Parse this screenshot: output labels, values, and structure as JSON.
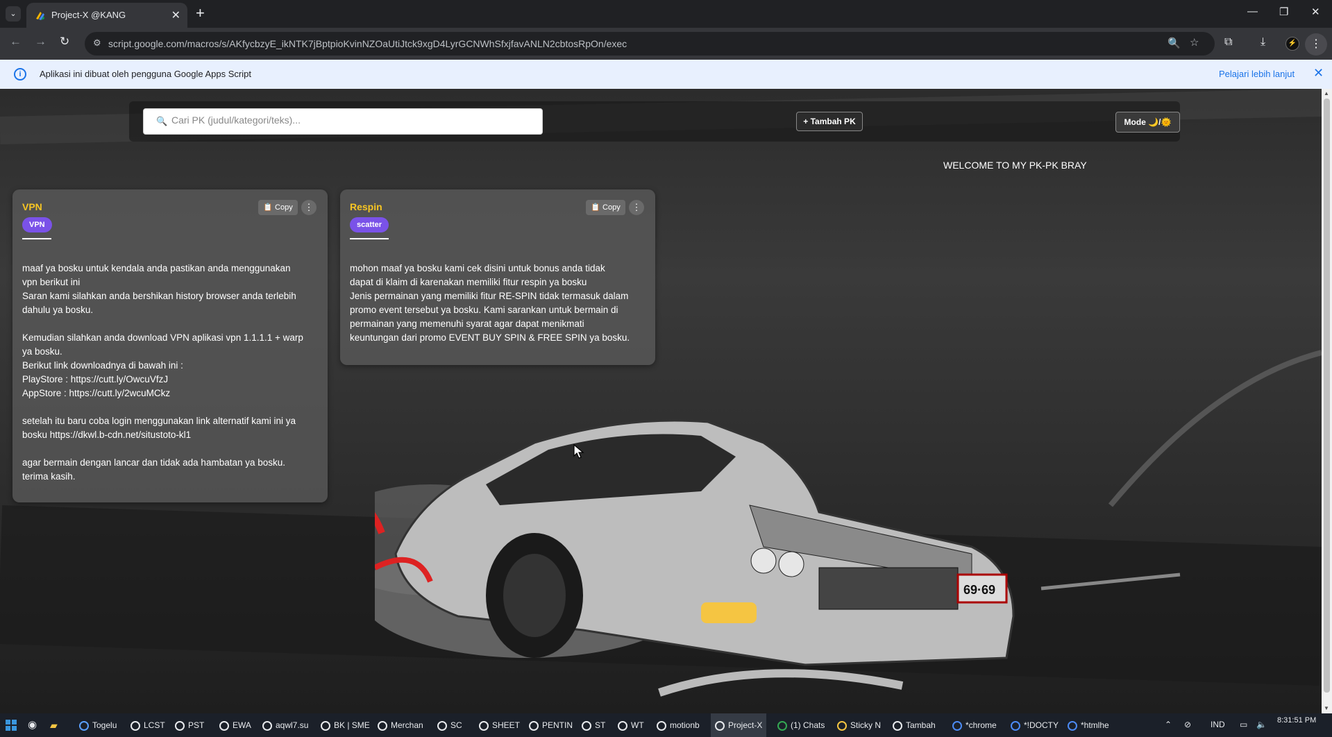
{
  "browser": {
    "tab": {
      "title": "Project-X @KANG"
    },
    "url": "script.google.com/macros/s/AKfycbzyE_ikNTK7jBptpioKvinNZOaUtiJtck9xgD4LyrGCNWhSfxjfavANLN2cbtosRpOn/exec"
  },
  "infobar": {
    "text": "Aplikasi ini dibuat oleh pengguna Google Apps Script",
    "link": "Pelajari lebih lanjut"
  },
  "app": {
    "search": {
      "placeholder": "Cari PK (judul/kategori/teks)..."
    },
    "add_button": "+ Tambah PK",
    "mode_button": "Mode 🌙/🌞",
    "welcome": "WELCOME TO MY PK-PK BRAY",
    "copy_label": "Copy",
    "cards": [
      {
        "title": "VPN",
        "tag": "VPN",
        "body": "maaf ya bosku untuk kendala anda pastikan anda menggunakan\nvpn berikut ini\nSaran kami silahkan anda bershikan history browser anda terlebih\ndahulu ya bosku.\n\nKemudian silahkan anda download VPN aplikasi vpn 1.1.1.1 + warp\nya bosku.\nBerikut link downloadnya di bawah ini :\nPlayStore : https://cutt.ly/OwcuVfzJ\nAppStore : https://cutt.ly/2wcuMCkz\n\nsetelah itu baru coba login menggunakan link alternatif kami ini ya\nbosku https://dkwl.b-cdn.net/situstoto-kl1\n\nagar bermain dengan lancar dan tidak ada hambatan ya bosku.\nterima kasih."
      },
      {
        "title": "Respin",
        "tag": "scatter",
        "body": "mohon maaf ya bosku kami cek disini untuk bonus anda tidak\ndapat di klaim di karenakan memiliki fitur respin ya bosku\nJenis permainan yang memiliki fitur RE-SPIN tidak termasuk dalam\npromo event tersebut ya bosku. Kami sarankan untuk bermain di\npermainan yang memenuhi syarat agar dapat menikmati\nkeuntungan dari promo EVENT BUY SPIN & FREE SPIN ya bosku."
      }
    ]
  },
  "taskbar": {
    "items": [
      "Togelu",
      "LCST",
      "PST",
      "EWA",
      "aqwl7.su",
      "BK | SME",
      "Merchan",
      "SC",
      "SHEET",
      "PENTIN",
      "ST",
      "WT",
      "motionb",
      "Project-X",
      "(1) Chats",
      "Sticky N",
      "Tambah",
      "*chrome",
      "*!DOCTY",
      "*htmlhe"
    ],
    "lang": "IND",
    "time": "8:31:51 PM"
  }
}
